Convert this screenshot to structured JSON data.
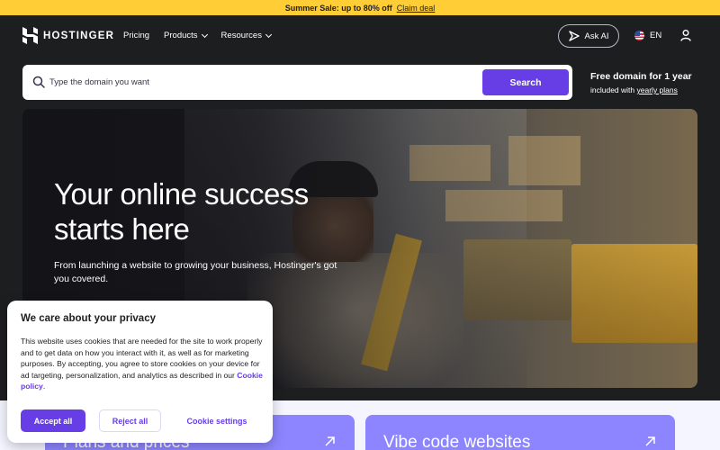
{
  "promo": {
    "text": "Summer Sale: up to 80% off",
    "link": "Claim deal"
  },
  "header": {
    "logo_text": "HOSTINGER",
    "nav": [
      {
        "label": "Pricing"
      },
      {
        "label": "Products"
      },
      {
        "label": "Resources"
      }
    ],
    "ask_ai": "Ask AI",
    "language": "EN"
  },
  "search": {
    "placeholder": "Type the domain you want",
    "button": "Search",
    "free_title": "Free domain for 1 year",
    "free_sub_prefix": "included with ",
    "free_sub_link": "yearly plans"
  },
  "hero": {
    "title": "Your online success starts here",
    "subtitle": "From launching a website to growing your business, Hostinger's got you covered."
  },
  "cards": [
    {
      "label": "Plans and prices"
    },
    {
      "label": "Vibe code websites"
    }
  ],
  "cookie": {
    "title": "We care about your privacy",
    "body": "This website uses cookies that are needed for the site to work properly and to get data on how you interact with it, as well as for marketing purposes. By accepting, you agree to store cookies on your device for ad targeting, personalization, and analytics as described in our ",
    "link": "Cookie policy",
    "body_end": ".",
    "accept": "Accept all",
    "reject": "Reject all",
    "settings": "Cookie settings"
  },
  "colors": {
    "promo": "#ffcd35",
    "brand_purple": "#673de6",
    "header_bg": "#1d1e20",
    "card": "#8c85ff"
  }
}
